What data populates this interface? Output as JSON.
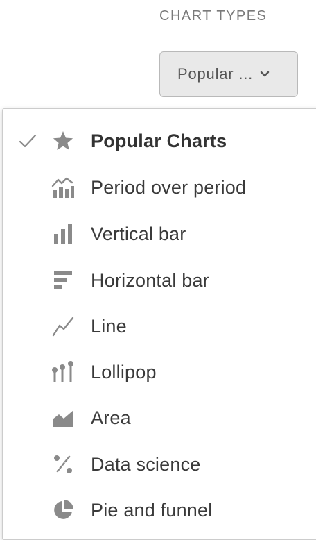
{
  "header": {
    "section_title": "CHART TYPES",
    "dropdown_value": "Popular ..."
  },
  "menu": {
    "items": [
      {
        "label": "Popular Charts",
        "icon": "star-icon",
        "selected": true
      },
      {
        "label": "Period over period",
        "icon": "period-over-period-icon",
        "selected": false
      },
      {
        "label": "Vertical bar",
        "icon": "vertical-bar-icon",
        "selected": false
      },
      {
        "label": "Horizontal bar",
        "icon": "horizontal-bar-icon",
        "selected": false
      },
      {
        "label": "Line",
        "icon": "line-chart-icon",
        "selected": false
      },
      {
        "label": "Lollipop",
        "icon": "lollipop-icon",
        "selected": false
      },
      {
        "label": "Area",
        "icon": "area-chart-icon",
        "selected": false
      },
      {
        "label": "Data science",
        "icon": "percent-icon",
        "selected": false
      },
      {
        "label": "Pie and funnel",
        "icon": "pie-chart-icon",
        "selected": false
      }
    ]
  },
  "colors": {
    "icon_gray": "#8a8a8a",
    "text_dark": "#333333",
    "trigger_bg": "#e9e9e9"
  }
}
